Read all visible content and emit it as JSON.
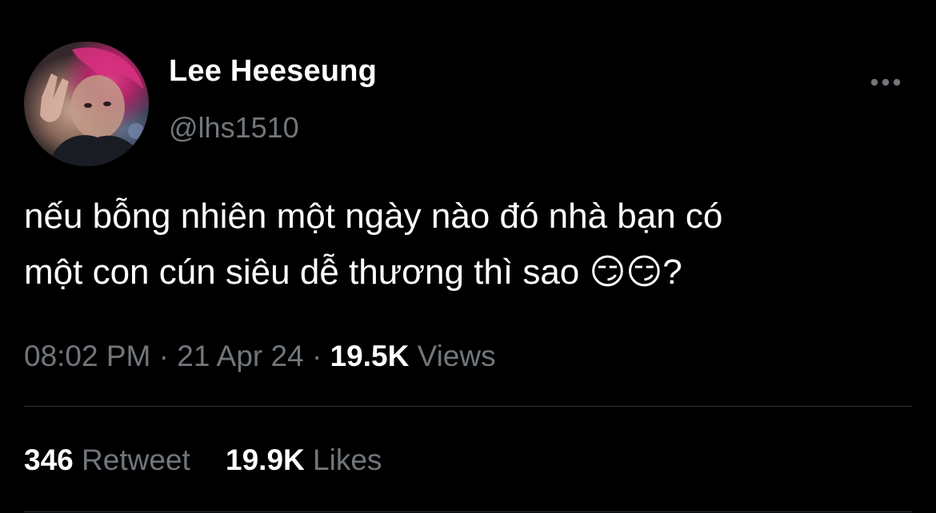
{
  "author": {
    "display_name": "Lee Heeseung",
    "handle": "@lhs1510",
    "avatar_icon": "profile-photo"
  },
  "menu": {
    "more_icon": "more-horizontal-icon"
  },
  "tweet": {
    "text": "nếu bỗng nhiên một ngày nào đó nhà bạn có\nmột con cún siêu dễ thương thì sao 😏😏?",
    "time": "08:02 PM",
    "separator": "·",
    "date": "21 Apr 24",
    "views_count": "19.5K",
    "views_label": "Views"
  },
  "stats": {
    "retweets_count": "346",
    "retweets_label": "Retweet",
    "likes_count": "19.9K",
    "likes_label": "Likes"
  },
  "colors": {
    "background": "#000000",
    "primary_text": "#ffffff",
    "secondary_text": "#71767b",
    "divider": "#2f3336"
  }
}
